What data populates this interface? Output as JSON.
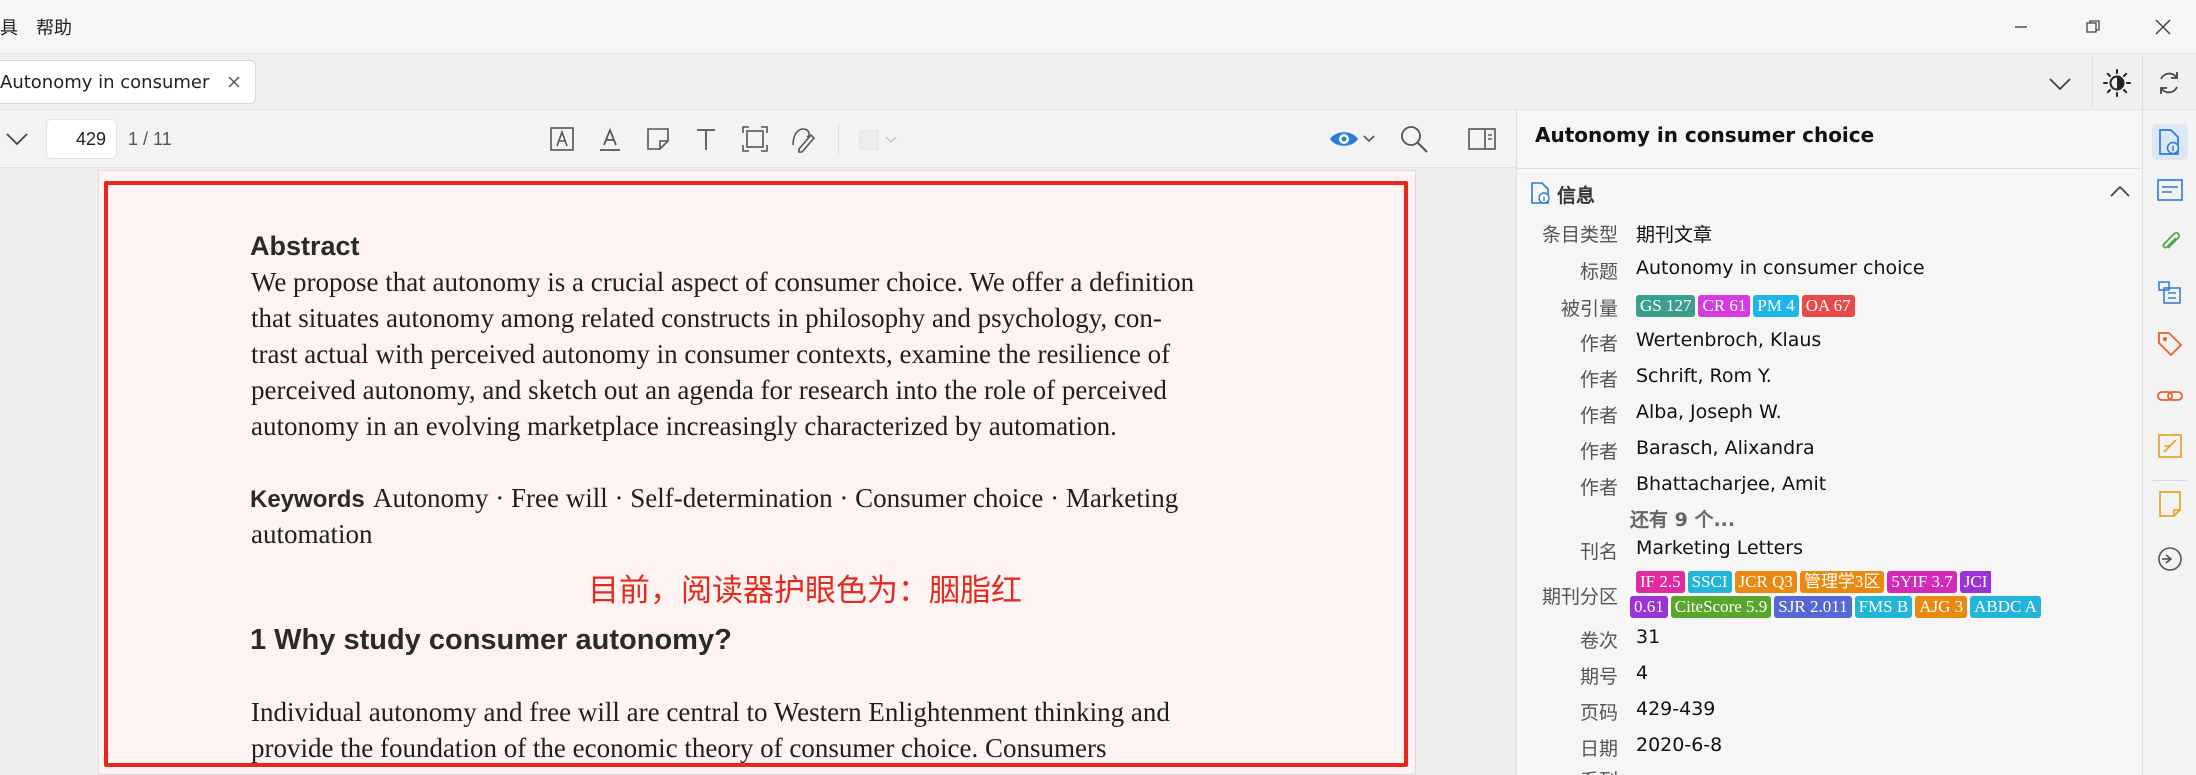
{
  "menu": {
    "tools_fragment": "具",
    "help": "帮助"
  },
  "tab": {
    "title": "Autonomy in consumer choice"
  },
  "toolbar": {
    "page_input": "429",
    "page_count": "1 / 11"
  },
  "document": {
    "abstract_heading": "Abstract",
    "abstract_lines": [
      "We propose that autonomy is a crucial aspect of consumer choice. We offer a definition",
      "that situates autonomy among related constructs in philosophy and psychology, con-",
      "trast actual with perceived autonomy in consumer contexts, examine the resilience of",
      "perceived autonomy, and sketch out an agenda for research into the role of perceived",
      "autonomy in an evolving marketplace increasingly characterized by automation."
    ],
    "keywords_label": "Keywords",
    "keywords_line1": "Autonomy · Free will · Self-determination · Consumer choice · Marketing",
    "keywords_line2": "automation",
    "notice": "目前，阅读器护眼色为：胭脂红",
    "section_heading": "1 Why study consumer autonomy?",
    "body_lines": [
      "Individual autonomy and free will are central to Western Enlightenment thinking and",
      "provide the foundation of the economic theory of consumer choice. Consumers"
    ]
  },
  "item_pane": {
    "title": "Autonomy in consumer choice",
    "section_info": "信息",
    "fields": {
      "item_type_label": "条目类型",
      "item_type": "期刊文章",
      "title_label": "标题",
      "title": "Autonomy in consumer choice",
      "citations_label": "被引量",
      "author_label": "作者",
      "authors": [
        "Wertenbroch, Klaus",
        "Schrift, Rom Y.",
        "Alba, Joseph W.",
        "Barasch, Alixandra",
        "Bhattacharjee, Amit"
      ],
      "more_authors": "还有 9 个...",
      "journal_label": "刊名",
      "journal": "Marketing Letters",
      "journal_rank_label": "期刊分区",
      "volume_label": "卷次",
      "volume": "31",
      "issue_label": "期号",
      "issue": "4",
      "pages_label": "页码",
      "pages": "429-439",
      "date_label": "日期",
      "date": "2020-6-8",
      "next_label": "系列"
    },
    "citation_badges": [
      {
        "text": "GS 127",
        "color": "#3aa08d"
      },
      {
        "text": "CR 61",
        "color": "#d63ae0"
      },
      {
        "text": "PM 4",
        "color": "#1eb6e8"
      },
      {
        "text": "OA 67",
        "color": "#e84a4a"
      }
    ],
    "rank_badges_row1": [
      {
        "text": "IF 2.5",
        "color": "#e02a9e"
      },
      {
        "text": "SSCI",
        "color": "#22b5d8"
      },
      {
        "text": "JCR Q3",
        "color": "#e88a12"
      },
      {
        "text": "管理学3区",
        "color": "#e88a12"
      },
      {
        "text": "5YIF 3.7",
        "color": "#d22ab8"
      },
      {
        "text": "JCI",
        "color": "#9b33d6"
      }
    ],
    "rank_badges_row2": [
      {
        "text": "0.61",
        "color": "#9b33d6"
      },
      {
        "text": "CiteScore 5.9",
        "color": "#58a72c"
      },
      {
        "text": "SJR 2.011",
        "color": "#5568d6"
      },
      {
        "text": "FMS B",
        "color": "#22b5d8"
      },
      {
        "text": "AJG 3",
        "color": "#e88a12"
      },
      {
        "text": "ABDC A",
        "color": "#22b5d8"
      }
    ]
  },
  "colors": {
    "accent": "#2b7bd8",
    "notice_red": "#e12a20",
    "side_orange": "#e8882a",
    "side_green": "#4aa84a"
  }
}
